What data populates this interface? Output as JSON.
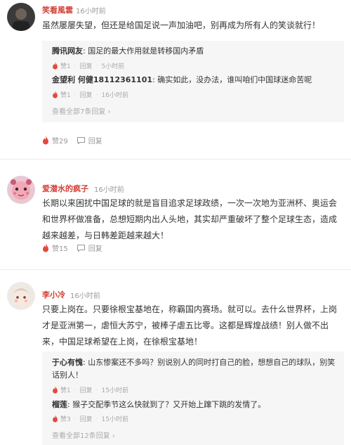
{
  "comments": [
    {
      "username": "笑看風雲",
      "time": "16小时前",
      "text": "虽然屡屡失望，但还是给国足说一声加油吧，别再成为所有人的笑谈就行！",
      "replies": [
        {
          "name": "腾讯网友",
          "text": "国足的最大作用就是转移国内矛盾",
          "meta_like": "赞1",
          "meta_reply": "回复",
          "meta_time": "5小时前"
        },
        {
          "name": "金望利 何健18112361101",
          "text": "确实如此，没办法，谁叫咱们中国球迷命苦呢",
          "meta_like": "赞1",
          "meta_reply": "回复",
          "meta_time": "16小时前"
        }
      ],
      "view_all": "查看全部7条回复",
      "likes": "赞29",
      "reply_label": "回复"
    },
    {
      "username": "爱潜水的疯子",
      "time": "16小时前",
      "text": "长期以来困扰中国足球的就是盲目追求足球政绩，一次一次地为亚洲杯、奥运会和世界杯做准备，总想短期内出人头地，其实却严重破坏了整个足球生态，造成越来越差，与日韩差距越来越大！",
      "likes": "赞15",
      "reply_label": "回复"
    },
    {
      "username": "李小冷",
      "time": "16小时前",
      "text": "只要上岗在。只要徐根宝基地在，称霸国内赛场。就可以。去什么世界杯，上岗才是亚洲第一，虐恒大苏宁，被棒子虐五比零。这都是辉煌战绩！别人做不出来，中国足球希望在上岗，在徐根宝基地！",
      "replies": [
        {
          "name": "于心有愧",
          "text": "山东惨案还不多吗？别说别人的同时打自己的脸，想想自己的球队，别笑话别人！",
          "meta_like": "赞1",
          "meta_reply": "回复",
          "meta_time": "15小时前"
        },
        {
          "name": "榴莲",
          "text": "猴子交配季节这么快就到了？又开始上蹿下跳的发情了。",
          "meta_like": "赞3",
          "meta_reply": "回复",
          "meta_time": "15小时前"
        }
      ],
      "view_all": "查看全部12条回复"
    }
  ],
  "colors": {
    "username": "#d23e32",
    "flame": "#e5473a",
    "reply_bg": "#f6f6f6"
  },
  "icons": {
    "like": "flame-icon",
    "reply": "comment-bubble-icon",
    "view_all": "chevron-right-icon"
  }
}
